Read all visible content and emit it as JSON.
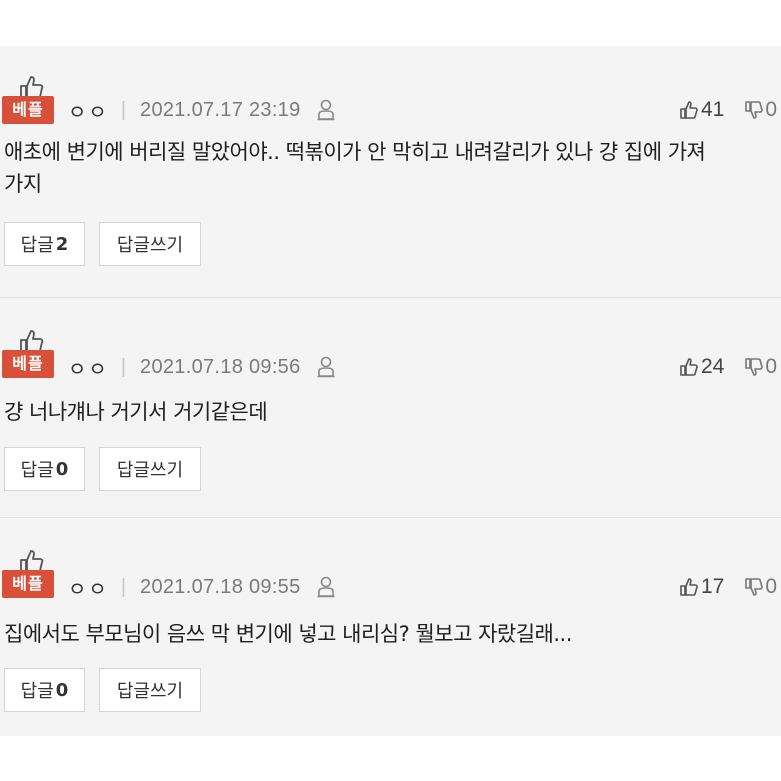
{
  "best_label": "베플",
  "colors": {
    "badge_bg": "#d9503a",
    "list_bg": "#f4f4f4"
  },
  "icons": {
    "badge": "thumbs-up-icon",
    "privacy": "person-icon",
    "like": "thumbs-up-icon",
    "dislike": "thumbs-down-icon"
  },
  "comments": [
    {
      "nickname": "ㅇㅇ",
      "datetime": "2021.07.17 23:19",
      "likes": "41",
      "dislikes": "0",
      "text_line1": "애초에 변기에 버리질 말았어야.. 떡볶이가 안 막히고 내려갈리가 있나 걍 집에 가져",
      "text_line2": "가지",
      "reply_label": "답글",
      "reply_count": "2",
      "write_label": "답글쓰기"
    },
    {
      "nickname": "ㅇㅇ",
      "datetime": "2021.07.18 09:56",
      "likes": "24",
      "dislikes": "0",
      "text_line1": "걍 너나걔나 거기서 거기같은데",
      "text_line2": "",
      "reply_label": "답글",
      "reply_count": "0",
      "write_label": "답글쓰기"
    },
    {
      "nickname": "ㅇㅇ",
      "datetime": "2021.07.18 09:55",
      "likes": "17",
      "dislikes": "0",
      "text_line1": "집에서도 부모님이 음쓰 막 변기에 넣고 내리심? 뭘보고 자랐길래...",
      "text_line2": "",
      "reply_label": "답글",
      "reply_count": "0",
      "write_label": "답글쓰기"
    }
  ]
}
